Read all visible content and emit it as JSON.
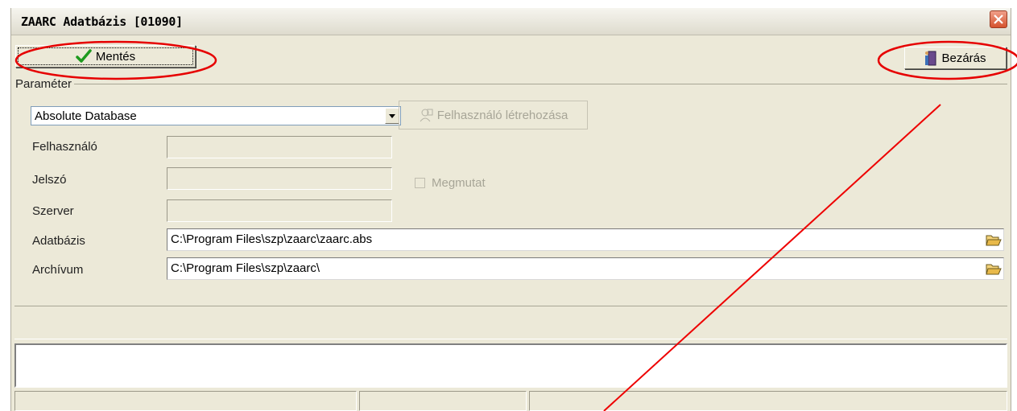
{
  "window": {
    "title": "ZAARC Adatbázis [01090]",
    "close_icon": "close-x-icon"
  },
  "toolbar": {
    "save_label": "Mentés",
    "save_icon": "checkmark-icon",
    "close_label": "Bezárás",
    "close_icon": "door-exit-icon"
  },
  "params": {
    "legend": "Paraméter",
    "database_type": {
      "value": "Absolute Database"
    },
    "create_user_label": "Felhasználó létrehozása",
    "user_label": "Felhasználó",
    "user_value": "",
    "password_label": "Jelszó",
    "password_value": "",
    "show_label": "Megmutat",
    "show_checked": false,
    "server_label": "Szerver",
    "server_value": "",
    "database_label": "Adatbázis",
    "database_value": "C:\\Program Files\\szp\\zaarc\\zaarc.abs",
    "archive_label": "Archívum",
    "archive_value": "C:\\Program Files\\szp\\zaarc\\"
  },
  "annotation_color": "#e60000",
  "arrow_color": "#ee0000"
}
